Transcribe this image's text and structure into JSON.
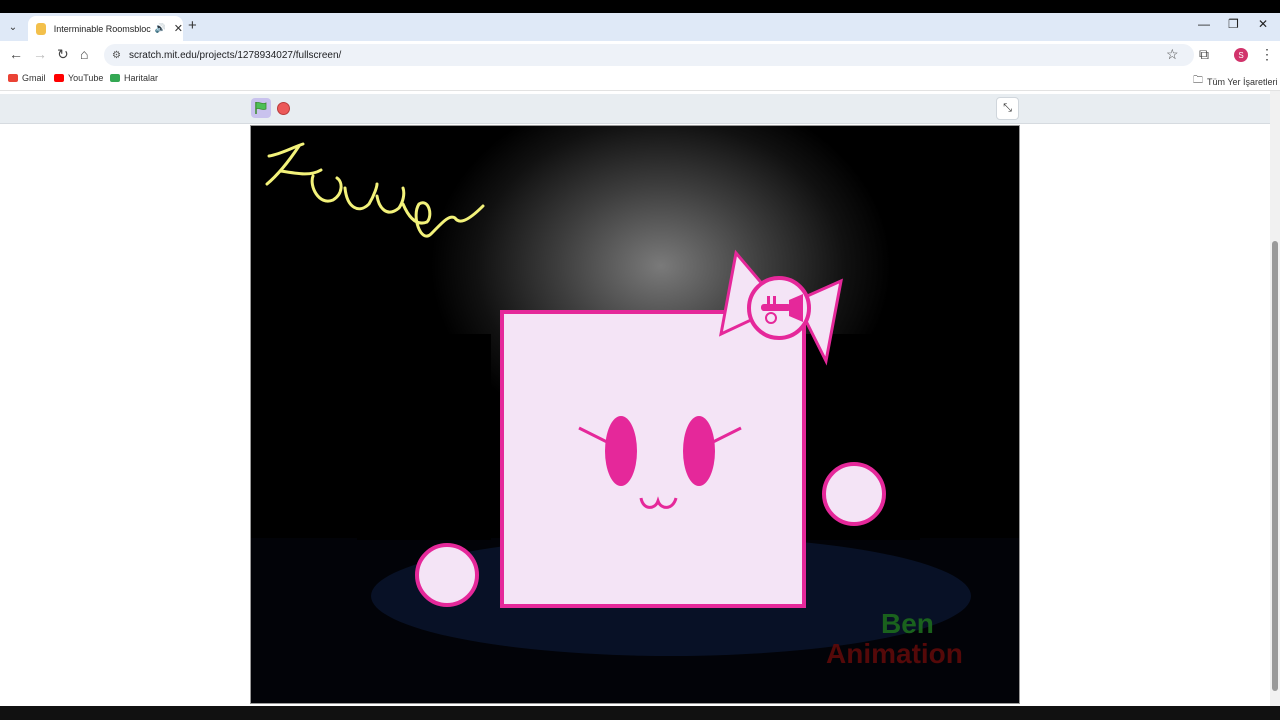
{
  "browser": {
    "tab_title": "Interminable Roomsblocks",
    "url": "scratch.mit.edu/projects/1278934027/fullscreen/",
    "profile_initial": "S",
    "bookmarks": [
      "Gmail",
      "YouTube",
      "Haritalar"
    ],
    "all_bookmarks_label": "Tüm Yer İşaretleri"
  },
  "icons": {
    "green_flag": "green-flag-icon",
    "stop": "stop-sign-icon",
    "exit_fullscreen": "exit-fullscreen-icon"
  },
  "stage": {
    "watermark_line1": "Ben",
    "watermark_line2": "Animation",
    "accent": "#e5289a",
    "block_fill": "#f4e4f6",
    "scribble_color": "#f3f27a"
  }
}
